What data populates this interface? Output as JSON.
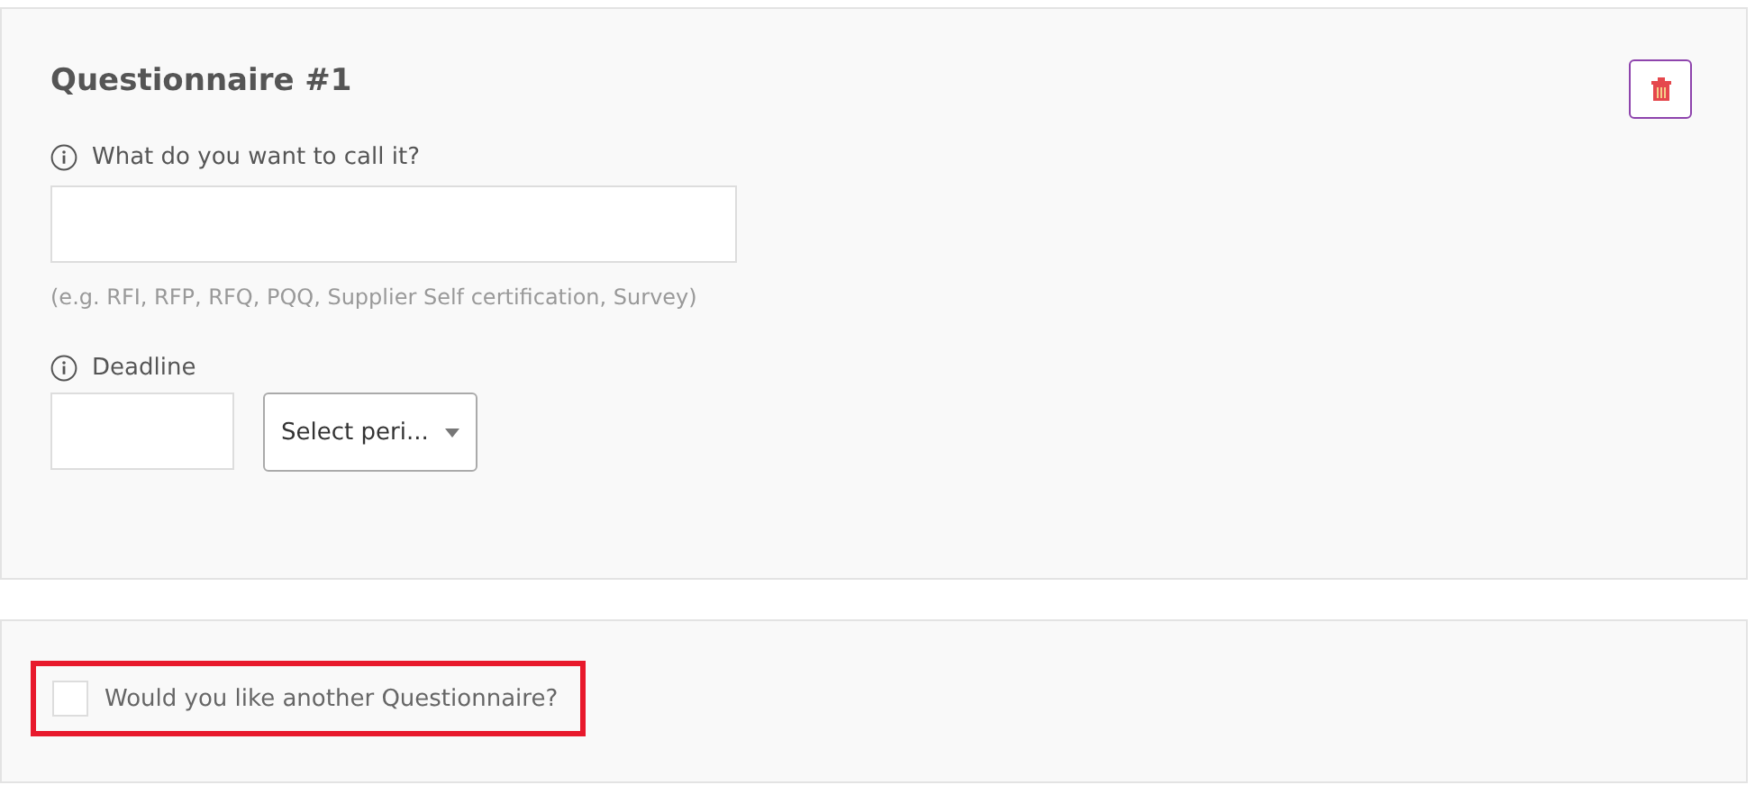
{
  "questionnaire": {
    "title": "Questionnaire #1",
    "name_field": {
      "label": "What do you want to call it?",
      "hint": "(e.g. RFI, RFP, RFQ, PQQ, Supplier Self certification, Survey)"
    },
    "deadline": {
      "label": "Deadline",
      "period_select": {
        "value": "Select peri..."
      }
    }
  },
  "another": {
    "label": "Would you like another Questionnaire?",
    "checked": false,
    "highlighted": true
  }
}
